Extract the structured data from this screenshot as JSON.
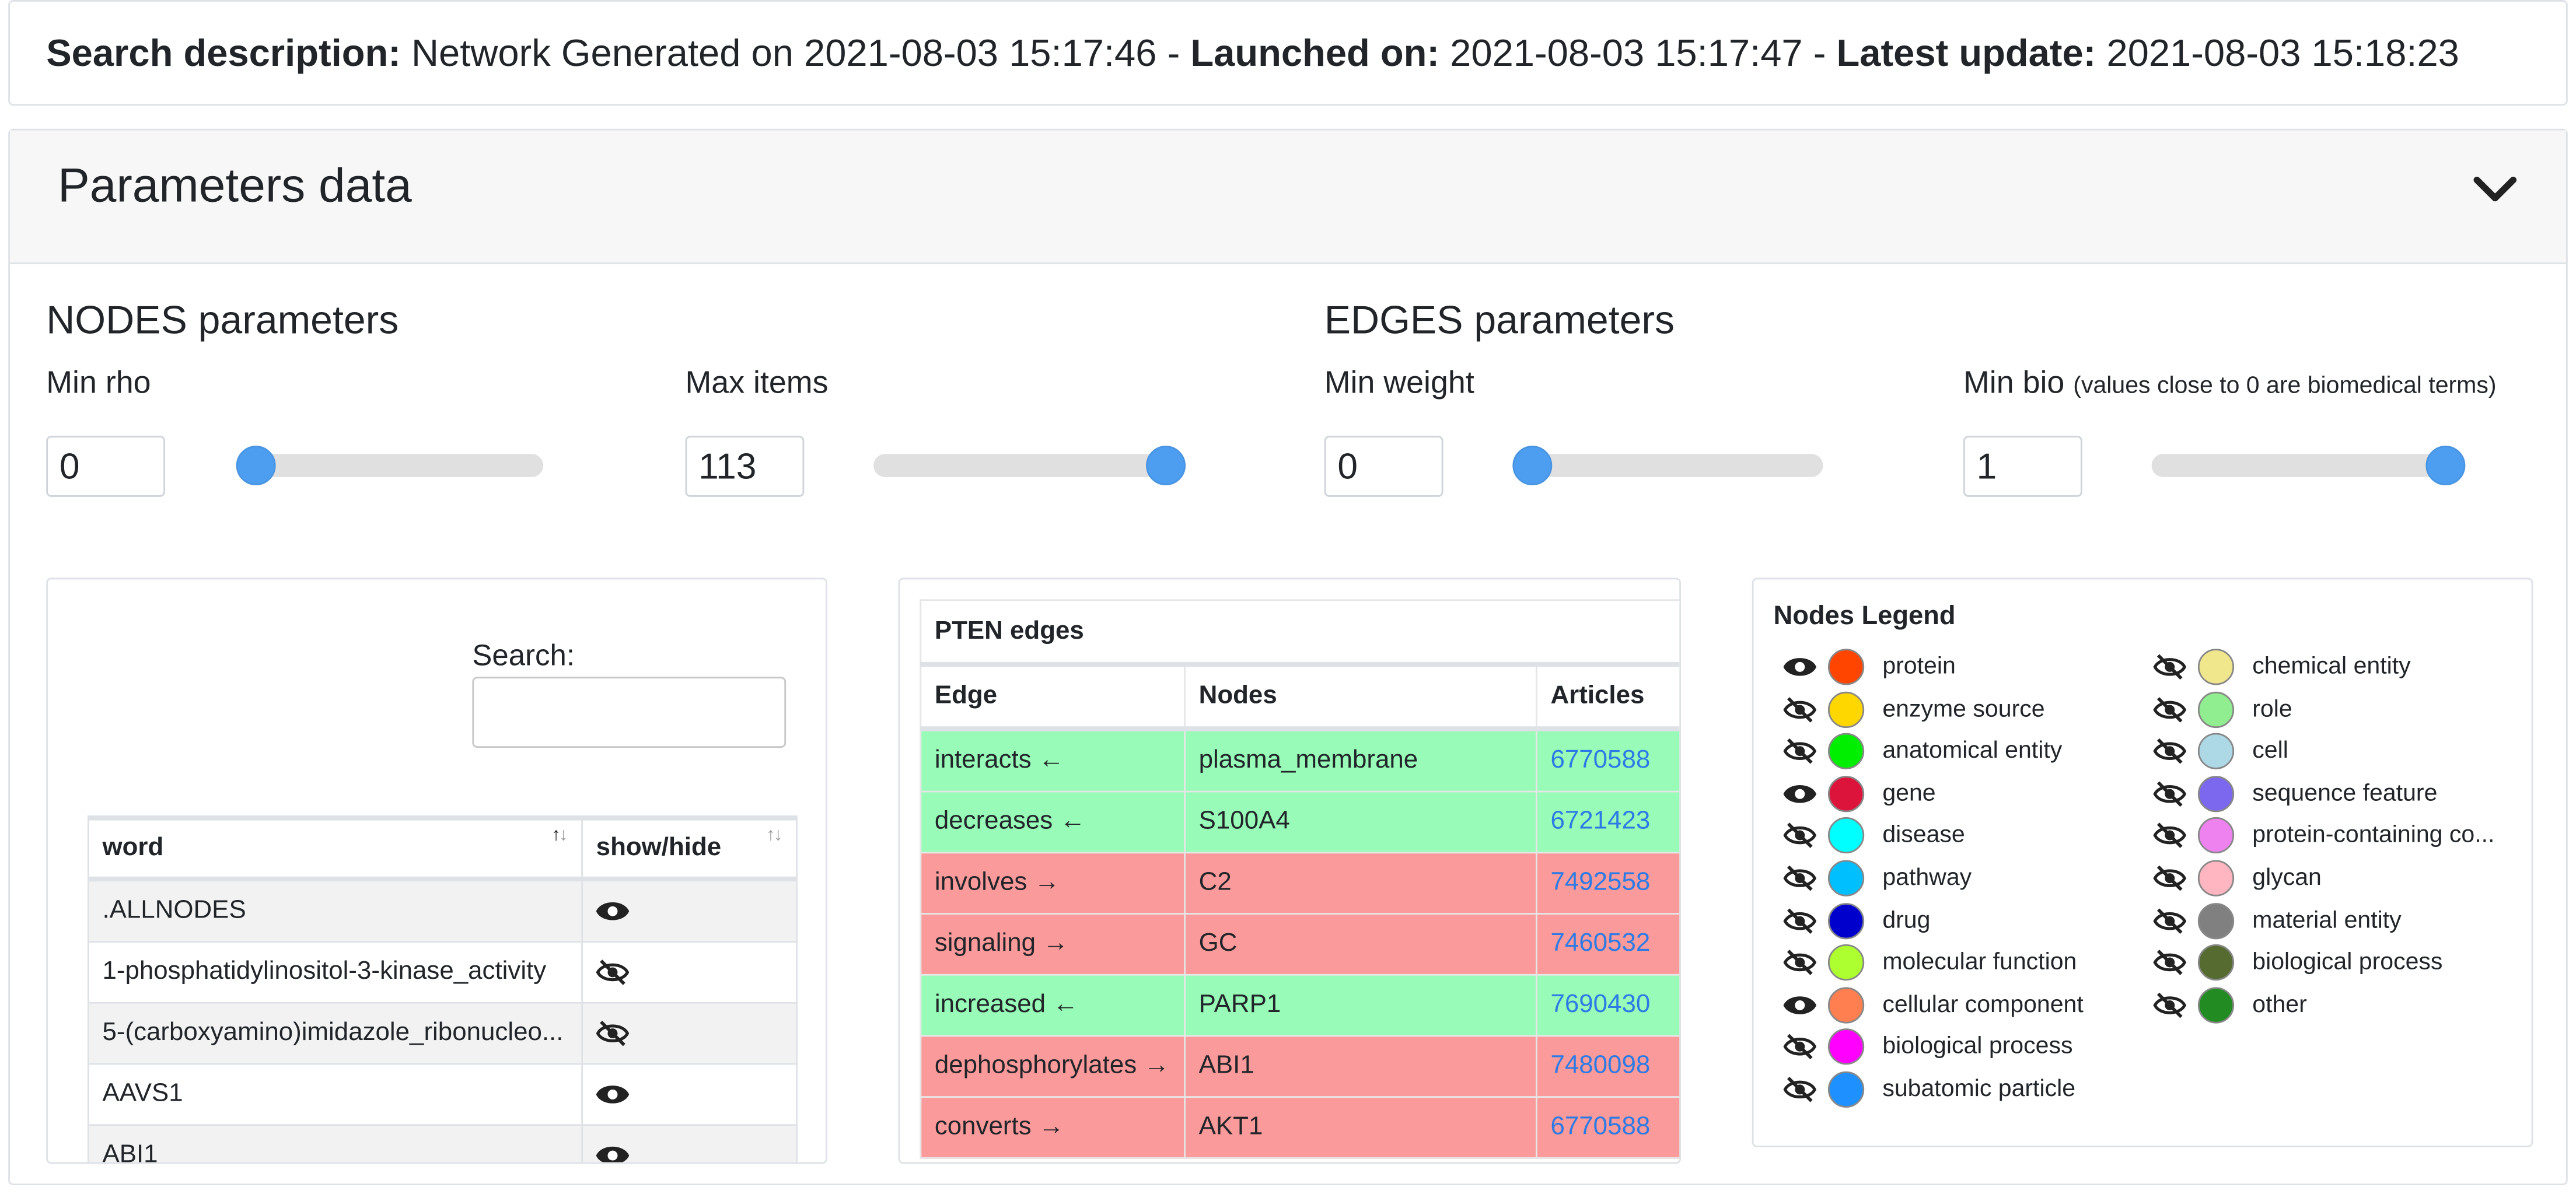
{
  "header": {
    "search_label": "Search description:",
    "search_value": "Network Generated on 2021-08-03 15:17:46",
    "launched_label": "Launched on:",
    "launched_value": "2021-08-03 15:17:47",
    "update_label": "Latest update:",
    "update_value": "2021-08-03 15:18:23",
    "separator": "-"
  },
  "params": {
    "title": "Parameters data",
    "nodes_title": "NODES parameters",
    "edges_title": "EDGES parameters",
    "min_rho": {
      "label": "Min rho",
      "value": "0",
      "level": 0.0
    },
    "max_items": {
      "label": "Max items",
      "value": "113",
      "level": 1.0
    },
    "min_weight": {
      "label": "Min weight",
      "value": "0",
      "level": 0.0
    },
    "min_bio": {
      "label": "Min bio",
      "note": "(values close to 0 are biomedical terms)",
      "value": "1",
      "level": 1.0
    },
    "slider_color": "#4d9ef0"
  },
  "words_panel": {
    "search_label": "Search:",
    "search_value": "",
    "columns": [
      "word",
      "show/hide"
    ],
    "rows": [
      {
        "word": ".ALLNODES",
        "visible": true
      },
      {
        "word": "1-phosphatidylinositol-3-kinase_activity",
        "visible": false
      },
      {
        "word": "5-(carboxyamino)imidazole_ribonucleo...",
        "visible": false
      },
      {
        "word": "AAVS1",
        "visible": true
      },
      {
        "word": "ABI1",
        "visible": true
      }
    ]
  },
  "edges_panel": {
    "caption": "PTEN edges",
    "columns": [
      "Edge",
      "Nodes",
      "Articles"
    ],
    "rows": [
      {
        "edge": "interacts",
        "dir": "←",
        "node": "plasma_membrane",
        "article": "6770588",
        "color": "#98fbb8"
      },
      {
        "edge": "decreases",
        "dir": "←",
        "node": "S100A4",
        "article": "6721423",
        "color": "#98fbb8"
      },
      {
        "edge": "involves",
        "dir": "→",
        "node": "C2",
        "article": "7492558",
        "color": "#fb9a9a"
      },
      {
        "edge": "signaling",
        "dir": "→",
        "node": "GC",
        "article": "7460532",
        "color": "#fb9a9a"
      },
      {
        "edge": "increased",
        "dir": "←",
        "node": "PARP1",
        "article": "7690430",
        "color": "#98fbb8"
      },
      {
        "edge": "dephosphorylates",
        "dir": "→",
        "node": "ABI1",
        "article": "7480098",
        "color": "#fb9a9a"
      },
      {
        "edge": "converts",
        "dir": "→",
        "node": "AKT1",
        "article": "6770588",
        "color": "#fb9a9a"
      }
    ]
  },
  "legend": {
    "title": "Nodes Legend",
    "col1": [
      {
        "label": "protein",
        "color": "#ff4500",
        "visible": true
      },
      {
        "label": "enzyme source",
        "color": "#ffd700",
        "visible": false
      },
      {
        "label": "anatomical entity",
        "color": "#00ee00",
        "visible": false
      },
      {
        "label": "gene",
        "color": "#dc143c",
        "visible": true
      },
      {
        "label": "disease",
        "color": "#00ffff",
        "visible": false
      },
      {
        "label": "pathway",
        "color": "#00bfff",
        "visible": false
      },
      {
        "label": "drug",
        "color": "#0000cd",
        "visible": false
      },
      {
        "label": "molecular function",
        "color": "#adff2f",
        "visible": false
      },
      {
        "label": "cellular component",
        "color": "#ff7f50",
        "visible": true
      },
      {
        "label": "biological process",
        "color": "#ff00ff",
        "visible": false
      },
      {
        "label": "subatomic particle",
        "color": "#1e90ff",
        "visible": false
      }
    ],
    "col2": [
      {
        "label": "chemical entity",
        "color": "#f0e68c",
        "visible": false
      },
      {
        "label": "role",
        "color": "#90ee90",
        "visible": false
      },
      {
        "label": "cell",
        "color": "#add8e6",
        "visible": false
      },
      {
        "label": "sequence feature",
        "color": "#7b68ee",
        "visible": false
      },
      {
        "label": "protein-containing co...",
        "color": "#ee82ee",
        "visible": false
      },
      {
        "label": "glycan",
        "color": "#ffb6c1",
        "visible": false
      },
      {
        "label": "material entity",
        "color": "#808080",
        "visible": false
      },
      {
        "label": "biological process",
        "color": "#556b2f",
        "visible": false
      },
      {
        "label": "other",
        "color": "#228b22",
        "visible": false
      }
    ]
  }
}
